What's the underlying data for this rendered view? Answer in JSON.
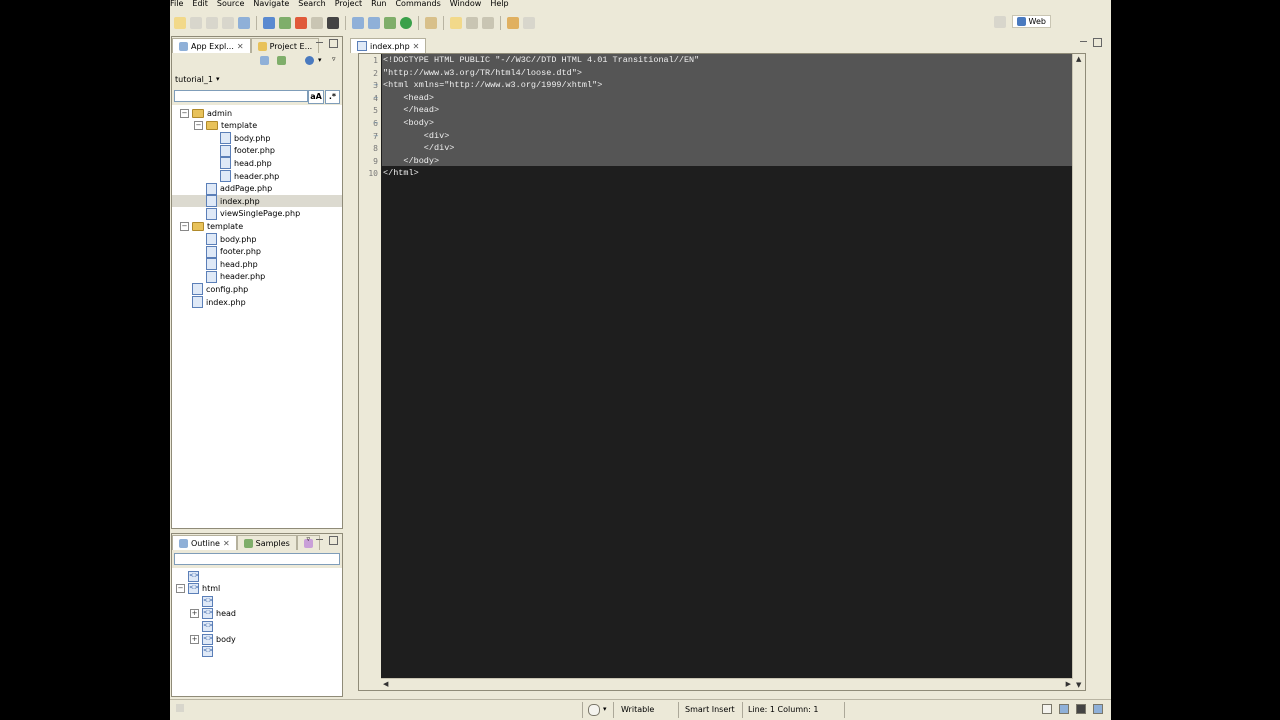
{
  "menu": [
    "File",
    "Edit",
    "Source",
    "Navigate",
    "Search",
    "Project",
    "Run",
    "Commands",
    "Window",
    "Help"
  ],
  "perspective": {
    "label": "Web"
  },
  "left_tabs": [
    {
      "label": "App Expl...",
      "active": true
    },
    {
      "label": "Project E...",
      "active": false
    }
  ],
  "project_selector": "tutorial_1",
  "filter": {
    "value": "",
    "case_label": "aA",
    "regex_label": ".*"
  },
  "tree": [
    {
      "label": "admin",
      "kind": "folder",
      "depth": 0,
      "expanded": true
    },
    {
      "label": "template",
      "kind": "folder",
      "depth": 1,
      "expanded": true
    },
    {
      "label": "body.php",
      "kind": "file",
      "depth": 2
    },
    {
      "label": "footer.php",
      "kind": "file",
      "depth": 2
    },
    {
      "label": "head.php",
      "kind": "file",
      "depth": 2
    },
    {
      "label": "header.php",
      "kind": "file",
      "depth": 2
    },
    {
      "label": "addPage.php",
      "kind": "file",
      "depth": 1
    },
    {
      "label": "index.php",
      "kind": "file",
      "depth": 1,
      "selected": true
    },
    {
      "label": "viewSinglePage.php",
      "kind": "file",
      "depth": 1
    },
    {
      "label": "template",
      "kind": "folder",
      "depth": 0,
      "expanded": true
    },
    {
      "label": "body.php",
      "kind": "file",
      "depth": 1
    },
    {
      "label": "footer.php",
      "kind": "file",
      "depth": 1
    },
    {
      "label": "head.php",
      "kind": "file",
      "depth": 1
    },
    {
      "label": "header.php",
      "kind": "file",
      "depth": 1
    },
    {
      "label": "config.php",
      "kind": "file",
      "depth": 0
    },
    {
      "label": "index.php",
      "kind": "file",
      "depth": 0
    }
  ],
  "outline_tabs": [
    {
      "label": "Outline",
      "active": true
    },
    {
      "label": "Samples",
      "active": false
    }
  ],
  "outline": [
    {
      "label": "",
      "depth": 1,
      "expander": false
    },
    {
      "label": "html",
      "depth": 1,
      "expander": true,
      "expanded": true
    },
    {
      "label": "",
      "depth": 2,
      "expander": false
    },
    {
      "label": "head",
      "depth": 2,
      "expander": true,
      "expanded": false
    },
    {
      "label": "",
      "depth": 2,
      "expander": false
    },
    {
      "label": "body",
      "depth": 2,
      "expander": true,
      "expanded": false
    },
    {
      "label": "",
      "depth": 2,
      "expander": false
    }
  ],
  "editor": {
    "tab_label": "index.php",
    "lines": [
      "<!DOCTYPE HTML PUBLIC \"-//W3C//DTD HTML 4.01 Transitional//EN\"",
      "\"http://www.w3.org/TR/html4/loose.dtd\">",
      "<html xmlns=\"http://www.w3.org/1999/xhtml\">",
      "    <head>",
      "    </head>",
      "    <body>",
      "        <div>",
      "        </div>",
      "    </body>",
      "</html>"
    ],
    "line_numbers": [
      "1",
      "2",
      "3",
      "4",
      "5",
      "6",
      "7",
      "8",
      "9",
      "10"
    ],
    "fold_markers": [
      "",
      "",
      "−",
      "−",
      "",
      "−",
      "−",
      "",
      "",
      ""
    ]
  },
  "status": {
    "writable": "Writable",
    "insert_mode": "Smart Insert",
    "position": "Line: 1 Column: 1"
  },
  "colors": {
    "chrome": "#ece9d8",
    "editor_bg": "#1e1e1e",
    "selection": "#555555",
    "code_text": "#f0f0f0"
  }
}
